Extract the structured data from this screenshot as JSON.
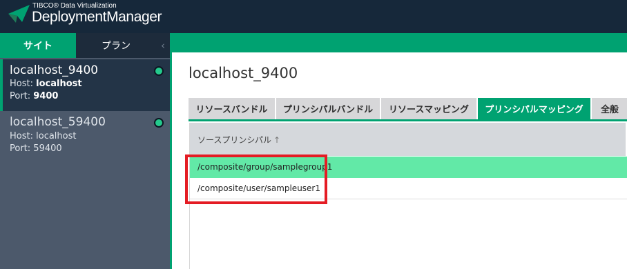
{
  "header": {
    "vendor": "TIBCO® Data Virtualization",
    "product_part1": "Deployment",
    "product_part2": "Manager",
    "logo_icon": "paper-plane-wing-icon",
    "background_color": "#16283a"
  },
  "sidebar": {
    "tabs": [
      {
        "label": "サイト",
        "active": true
      },
      {
        "label": "プラン",
        "active": false
      }
    ],
    "collapse_icon": "chevron-left-icon",
    "collapse_glyph": "‹",
    "servers": [
      {
        "name": "localhost_9400",
        "host_label": "Host:",
        "host": "localhost",
        "port_label": "Port:",
        "port": "9400",
        "selected": true,
        "status": "online",
        "status_color": "#24c98c"
      },
      {
        "name": "localhost_59400",
        "host_label": "Host:",
        "host": "localhost",
        "port_label": "Port:",
        "port": "59400",
        "selected": false,
        "status": "online",
        "status_color": "#24c98c"
      }
    ]
  },
  "main": {
    "title": "localhost_9400",
    "tabs": [
      {
        "label": "リソースバンドル",
        "active": false
      },
      {
        "label": "プリンシパルバンドル",
        "active": false
      },
      {
        "label": "リソースマッピング",
        "active": false
      },
      {
        "label": "プリンシパルマッピング",
        "active": true
      },
      {
        "label": "全般",
        "active": false
      }
    ],
    "table": {
      "column_header": "ソースプリンシパル",
      "sort_icon": "sort-ascending-icon",
      "sort_glyph": "↑",
      "rows": [
        {
          "source_principal": "/composite/group/samplegroup1",
          "selected": true
        },
        {
          "source_principal": "/composite/user/sampleuser1",
          "selected": false
        }
      ]
    }
  },
  "colors": {
    "accent": "#00a271",
    "selected_row": "#62e9a7",
    "annotation_box": "#e41c24",
    "sidebar_bg": "#4c596b"
  }
}
